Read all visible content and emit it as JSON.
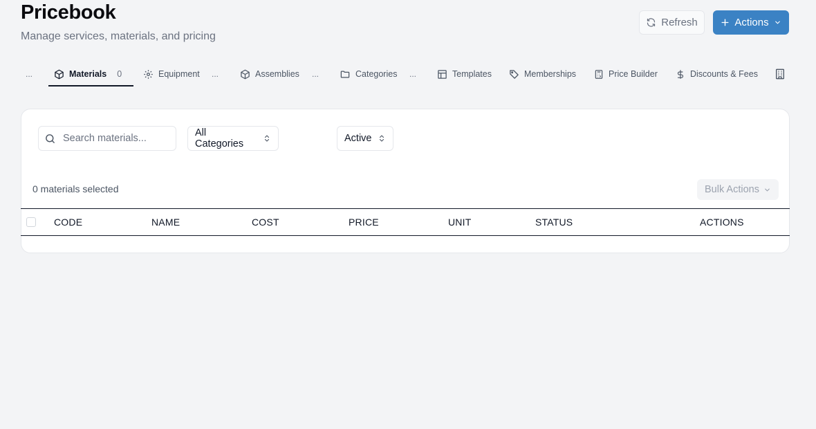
{
  "header": {
    "title": "Pricebook",
    "subtitle": "Manage services, materials, and pricing",
    "refresh_label": "Refresh",
    "actions_label": "Actions"
  },
  "tabs": {
    "leading_ellipsis": "...",
    "items": [
      {
        "label": "Materials",
        "count": "0",
        "icon": "box-icon",
        "active": true
      },
      {
        "label": "Equipment",
        "suffix": "...",
        "icon": "gear-icon"
      },
      {
        "label": "Assemblies",
        "suffix": "...",
        "icon": "box-icon"
      },
      {
        "label": "Categories",
        "suffix": "...",
        "icon": "folder-icon"
      },
      {
        "label": "Templates",
        "icon": "layout-icon"
      },
      {
        "label": "Memberships",
        "icon": "tag-icon"
      },
      {
        "label": "Price Builder",
        "icon": "calculator-icon"
      },
      {
        "label": "Discounts & Fees",
        "icon": "dollar-icon"
      },
      {
        "label": "",
        "icon": "building-icon"
      }
    ]
  },
  "filters": {
    "search_placeholder": "Search materials...",
    "category_value": "All Categories",
    "status_value": "Active"
  },
  "selection": {
    "count_text": "0 materials selected",
    "bulk_actions_label": "Bulk Actions"
  },
  "table": {
    "columns": [
      "CODE",
      "NAME",
      "COST",
      "PRICE",
      "UNIT",
      "STATUS",
      "ACTIONS"
    ],
    "rows": []
  },
  "colors": {
    "primary": "#3b82c4",
    "background": "#f3f4f6",
    "text": "#111827",
    "muted": "#6b7280"
  }
}
